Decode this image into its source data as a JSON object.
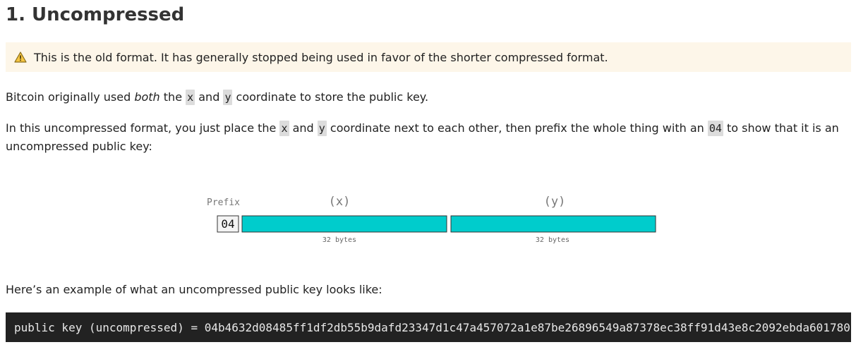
{
  "heading": "1. Uncompressed",
  "warning": {
    "icon": "warning-icon",
    "text": "This is the old format. It has generally stopped being used in favor of the shorter compressed format."
  },
  "para1": {
    "t1": "Bitcoin originally used ",
    "em": "both",
    "t2": " the ",
    "c1": "x",
    "t3": " and ",
    "c2": "y",
    "t4": " coordinate to store the public key."
  },
  "para2": {
    "t1": "In this uncompressed format, you just place the ",
    "c1": "x",
    "t2": " and ",
    "c2": "y",
    "t3": " coordinate next to each other, then prefix the whole thing with an ",
    "c3": "04",
    "t4": " to show that it is an uncompressed public key:"
  },
  "diagram": {
    "prefix_label": "Prefix",
    "prefix_value": "04",
    "x_label": "(x)",
    "y_label": "(y)",
    "x_size": "32 bytes",
    "y_size": "32 bytes",
    "fill_color": "#00cccc"
  },
  "para3": "Here’s an example of what an uncompressed public key looks like:",
  "code": "public key (uncompressed) = 04b4632d08485ff1df2db55b9dafd23347d1c47a457072a1e87be26896549a87378ec38ff91d43e8c2092ebda601780"
}
